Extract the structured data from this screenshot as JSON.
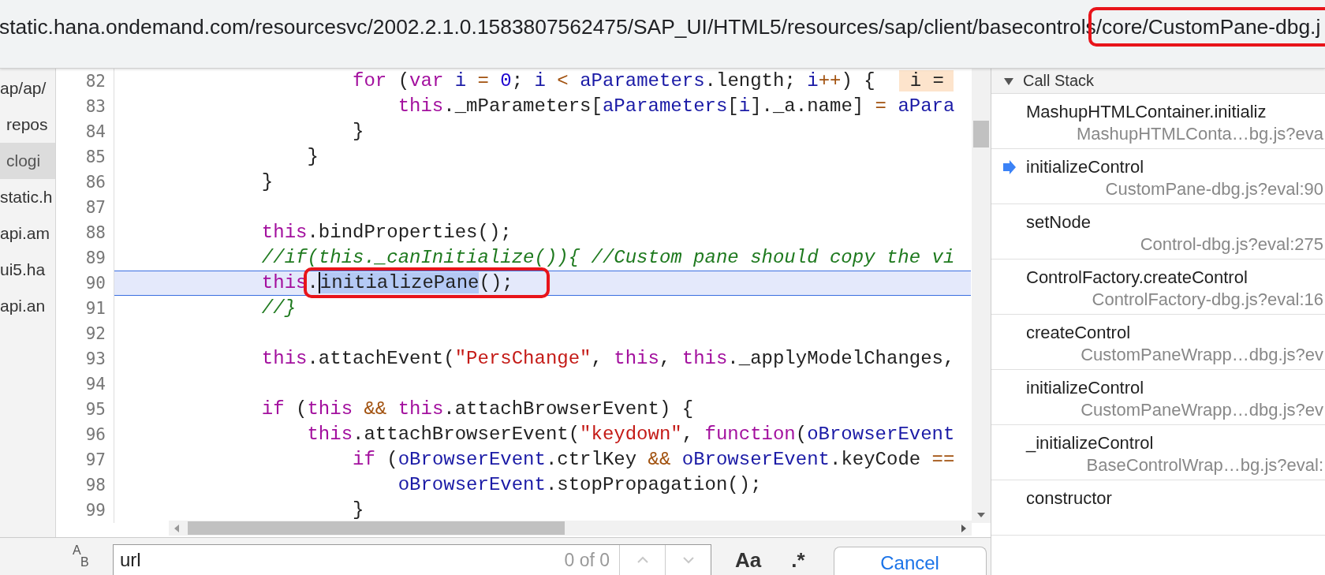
{
  "address_bar": {
    "text": "static.hana.ondemand.com/resourcesvc/2002.2.1.0.1583807562475/SAP_UI/HTML5/resources/sap/client/basecontrols",
    "marked_text": "/core/CustomPane-dbg.j"
  },
  "file_tree": {
    "items": [
      {
        "label": "ap/ap/",
        "selected": false,
        "children": [
          {
            "label": "repos",
            "selected": false
          },
          {
            "label": "clogi",
            "selected": true
          }
        ]
      },
      {
        "label": "static.h",
        "selected": false
      },
      {
        "label": "api.am",
        "selected": false
      },
      {
        "label": "ui5.ha",
        "selected": false
      },
      {
        "label": "api.an",
        "selected": false
      }
    ]
  },
  "editor": {
    "lines": [
      {
        "number": "82",
        "current": false,
        "tokens": [
          {
            "kind": "keyword",
            "text": "                    for"
          },
          {
            "kind": "plain",
            "text": " ("
          },
          {
            "kind": "keyword",
            "text": "var"
          },
          {
            "kind": "variable",
            "text": " i"
          },
          {
            "kind": "operator",
            "text": " ="
          },
          {
            "kind": "number",
            "text": " 0"
          },
          {
            "kind": "plain",
            "text": "; "
          },
          {
            "kind": "variable",
            "text": "i"
          },
          {
            "kind": "operator",
            "text": " <"
          },
          {
            "kind": "variable",
            "text": " aParameters"
          },
          {
            "kind": "plain",
            "text": ".length; "
          },
          {
            "kind": "variable",
            "text": "i"
          },
          {
            "kind": "operator",
            "text": "++"
          },
          {
            "kind": "plain",
            "text": ") {"
          },
          {
            "kind": "inline-value",
            "text": "i ="
          }
        ]
      },
      {
        "number": "83",
        "current": false,
        "tokens": [
          {
            "kind": "keyword",
            "text": "                        this"
          },
          {
            "kind": "plain",
            "text": "._mParameters["
          },
          {
            "kind": "variable",
            "text": "aParameters"
          },
          {
            "kind": "plain",
            "text": "["
          },
          {
            "kind": "variable",
            "text": "i"
          },
          {
            "kind": "plain",
            "text": "]._a.name] "
          },
          {
            "kind": "operator",
            "text": "="
          },
          {
            "kind": "variable",
            "text": " aPara"
          }
        ]
      },
      {
        "number": "84",
        "current": false,
        "tokens": [
          {
            "kind": "plain",
            "text": "                    }"
          }
        ]
      },
      {
        "number": "85",
        "current": false,
        "tokens": [
          {
            "kind": "plain",
            "text": "                }"
          }
        ]
      },
      {
        "number": "86",
        "current": false,
        "tokens": [
          {
            "kind": "plain",
            "text": "            }"
          }
        ]
      },
      {
        "number": "87",
        "current": false
      },
      {
        "number": "88",
        "current": false,
        "tokens": [
          {
            "kind": "keyword",
            "text": "            this"
          },
          {
            "kind": "plain",
            "text": ".bindProperties();"
          }
        ]
      },
      {
        "number": "89",
        "current": false,
        "tokens": [
          {
            "kind": "comment",
            "text": "            //if(this._canInitialize()){ //Custom pane should copy the vi"
          }
        ]
      },
      {
        "number": "90",
        "current": true,
        "tokens": [
          {
            "kind": "keyword",
            "text": "            this"
          },
          {
            "kind": "marked-group",
            "tokens": [
              {
                "kind": "plain",
                "text": "."
              },
              {
                "kind": "selection",
                "text": "initializePane"
              },
              {
                "kind": "plain",
                "text": "();"
              }
            ]
          }
        ]
      },
      {
        "number": "91",
        "current": false,
        "tokens": [
          {
            "kind": "comment",
            "text": "            //}"
          }
        ]
      },
      {
        "number": "92",
        "current": false
      },
      {
        "number": "93",
        "current": false,
        "tokens": [
          {
            "kind": "keyword",
            "text": "            this"
          },
          {
            "kind": "plain",
            "text": ".attachEvent("
          },
          {
            "kind": "string",
            "text": "\"PersChange\""
          },
          {
            "kind": "plain",
            "text": ", "
          },
          {
            "kind": "keyword",
            "text": "this"
          },
          {
            "kind": "plain",
            "text": ", "
          },
          {
            "kind": "keyword",
            "text": "this"
          },
          {
            "kind": "plain",
            "text": "._applyModelChanges,"
          }
        ]
      },
      {
        "number": "94",
        "current": false
      },
      {
        "number": "95",
        "current": false,
        "tokens": [
          {
            "kind": "keyword",
            "text": "            if"
          },
          {
            "kind": "plain",
            "text": " ("
          },
          {
            "kind": "keyword",
            "text": "this"
          },
          {
            "kind": "operator",
            "text": " &&"
          },
          {
            "kind": "keyword",
            "text": " this"
          },
          {
            "kind": "plain",
            "text": ".attachBrowserEvent) {"
          }
        ]
      },
      {
        "number": "96",
        "current": false,
        "tokens": [
          {
            "kind": "keyword",
            "text": "                this"
          },
          {
            "kind": "plain",
            "text": ".attachBrowserEvent("
          },
          {
            "kind": "string",
            "text": "\"keydown\""
          },
          {
            "kind": "plain",
            "text": ", "
          },
          {
            "kind": "keyword",
            "text": "function"
          },
          {
            "kind": "plain",
            "text": "("
          },
          {
            "kind": "variable",
            "text": "oBrowserEvent"
          }
        ]
      },
      {
        "number": "97",
        "current": false,
        "tokens": [
          {
            "kind": "keyword",
            "text": "                    if"
          },
          {
            "kind": "plain",
            "text": " ("
          },
          {
            "kind": "variable",
            "text": "oBrowserEvent"
          },
          {
            "kind": "plain",
            "text": ".ctrlKey "
          },
          {
            "kind": "operator",
            "text": "&&"
          },
          {
            "kind": "variable",
            "text": " oBrowserEvent"
          },
          {
            "kind": "plain",
            "text": ".keyCode "
          },
          {
            "kind": "operator",
            "text": "=="
          }
        ]
      },
      {
        "number": "98",
        "current": false,
        "tokens": [
          {
            "kind": "variable",
            "text": "                        oBrowserEvent"
          },
          {
            "kind": "plain",
            "text": ".stopPropagation();"
          }
        ]
      },
      {
        "number": "99",
        "current": false,
        "tokens": [
          {
            "kind": "plain",
            "text": "                    }"
          }
        ]
      }
    ]
  },
  "call_stack": {
    "title": "Call Stack",
    "expanded": true,
    "frames": [
      {
        "name": "MashupHTMLContainer.initializ",
        "location": "MashupHTMLConta…bg.js?eva",
        "current": false
      },
      {
        "name": "initializeControl",
        "location": "CustomPane-dbg.js?eval:90",
        "current": true
      },
      {
        "name": "setNode",
        "location": "Control-dbg.js?eval:275",
        "current": false
      },
      {
        "name": "ControlFactory.createControl",
        "location": "ControlFactory-dbg.js?eval:16",
        "current": false
      },
      {
        "name": "createControl",
        "location": "CustomPaneWrapp…dbg.js?ev",
        "current": false
      },
      {
        "name": "initializeControl",
        "location": "CustomPaneWrapp…dbg.js?ev",
        "current": false
      },
      {
        "name": "_initializeControl",
        "location": "BaseControlWrap…bg.js?eval:",
        "current": false
      },
      {
        "name": "constructor",
        "current": false
      }
    ]
  },
  "search_bar": {
    "replace_toggle": [
      "A",
      "B"
    ],
    "value": "url",
    "match_count": "0 of 0",
    "previous_disabled": true,
    "next_disabled": true,
    "case_button": "Aa",
    "regex_button": ".*",
    "cancel_button": "Cancel"
  }
}
